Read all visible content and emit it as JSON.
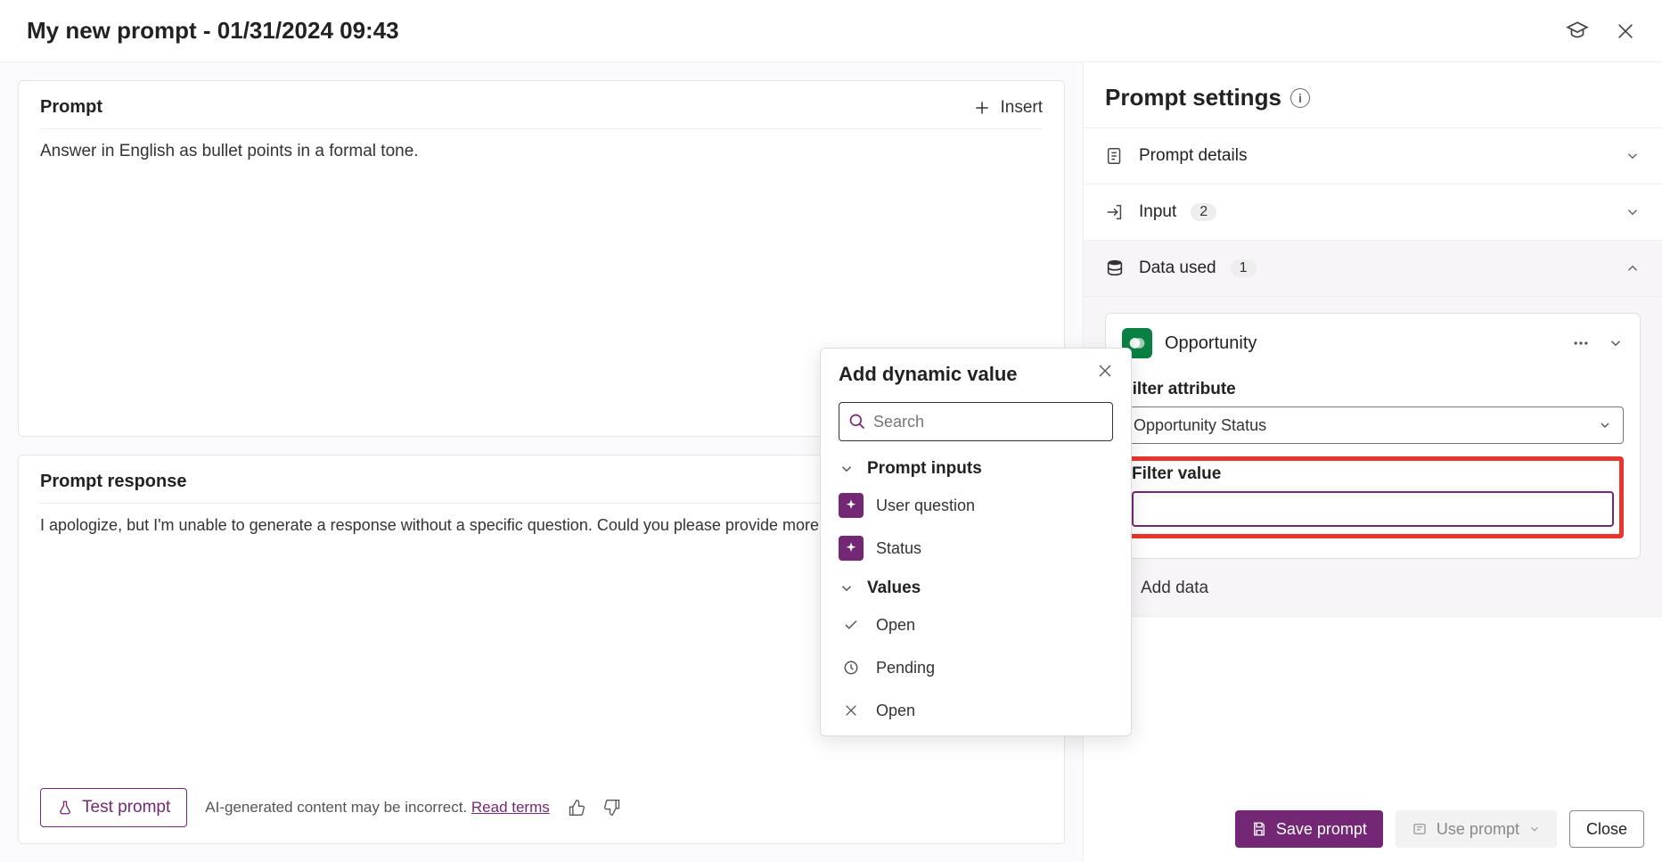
{
  "header": {
    "title": "My new prompt - 01/31/2024 09:43"
  },
  "prompt": {
    "section_title": "Prompt",
    "insert_label": "Insert",
    "body": "Answer in English as bullet points in a formal tone."
  },
  "response": {
    "section_title": "Prompt response",
    "body": "I apologize, but I'm unable to generate a response without a specific question. Could you please provide more de",
    "test_label": "Test prompt",
    "disclaimer": "AI-generated content may be incorrect.",
    "read_terms": "Read terms"
  },
  "popover": {
    "title": "Add dynamic value",
    "search_placeholder": "Search",
    "sections": {
      "inputs_label": "Prompt inputs",
      "values_label": "Values"
    },
    "inputs": [
      {
        "label": "User question"
      },
      {
        "label": "Status"
      }
    ],
    "values": [
      {
        "icon": "check",
        "label": "Open"
      },
      {
        "icon": "clock",
        "label": "Pending"
      },
      {
        "icon": "x",
        "label": "Open"
      }
    ]
  },
  "settings": {
    "title": "Prompt settings",
    "rows": {
      "details_label": "Prompt details",
      "input_label": "Input",
      "input_count": "2",
      "data_used_label": "Data used",
      "data_used_count": "1"
    },
    "opportunity": {
      "title": "Opportunity",
      "filter_attribute_label": "Filter attribute",
      "filter_attribute_value": "Opportunity Status",
      "filter_value_label": "Filter value",
      "filter_value": ""
    },
    "add_data_label": "Add data"
  },
  "footer": {
    "save_label": "Save prompt",
    "use_label": "Use prompt",
    "close_label": "Close"
  }
}
